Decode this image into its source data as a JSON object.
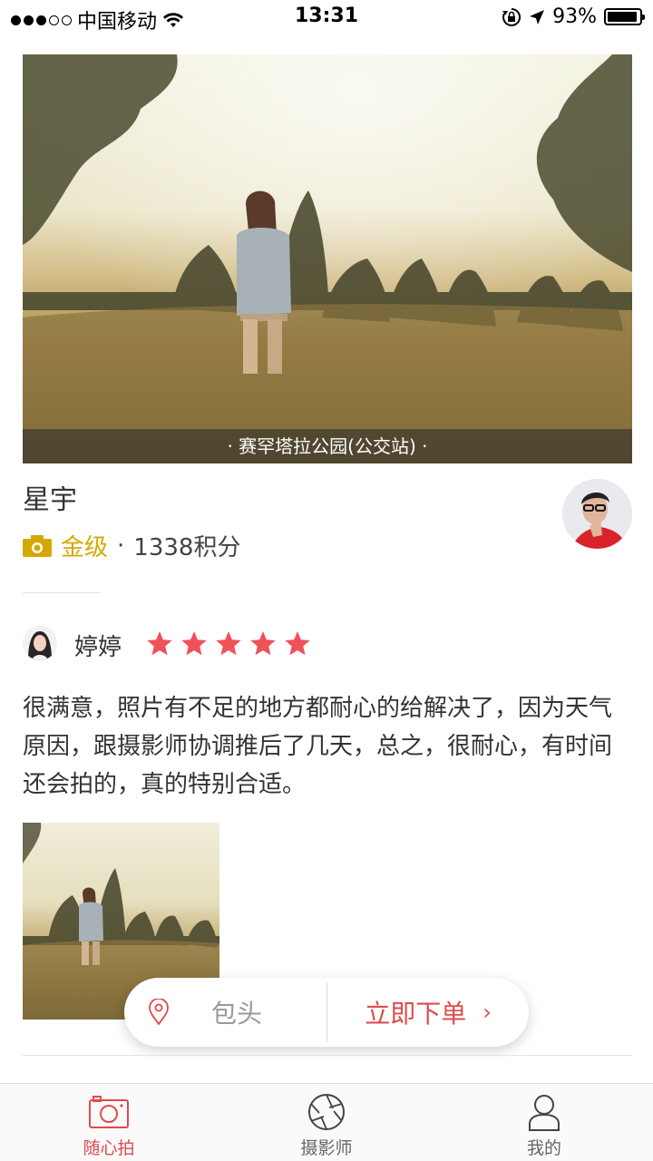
{
  "status_bar": {
    "carrier": "中国移动",
    "time": "13:31",
    "battery": "93%",
    "battery_level": 0.93,
    "signal_filled": 3,
    "signal_total": 5,
    "icons": [
      "wifi-icon",
      "orientation-lock-icon",
      "location-arrow-icon",
      "battery-icon"
    ]
  },
  "hero": {
    "caption": "· 赛罕塔拉公园(公交站) ·"
  },
  "photographer": {
    "name": "星宇",
    "level": "金级",
    "separator": "·",
    "points": "1338积分",
    "level_color": "#d5a800"
  },
  "review": {
    "reviewer": "婷婷",
    "rating": 5,
    "rating_max": 5,
    "star_color": "#f0515a",
    "text": "很满意，照片有不足的地方都耐心的给解决了，因为天气原因，跟摄影师协调推后了几天，总之，很耐心，有时间还会拍的，真的特别合适。"
  },
  "order_bar": {
    "city": "包头",
    "order_label": "立即下单",
    "chevron": "›",
    "accent": "#e24a4f"
  },
  "tabs": [
    {
      "label": "随心拍",
      "icon": "camera-icon",
      "active": true
    },
    {
      "label": "摄影师",
      "icon": "aperture-icon",
      "active": false
    },
    {
      "label": "我的",
      "icon": "user-icon",
      "active": false
    }
  ]
}
